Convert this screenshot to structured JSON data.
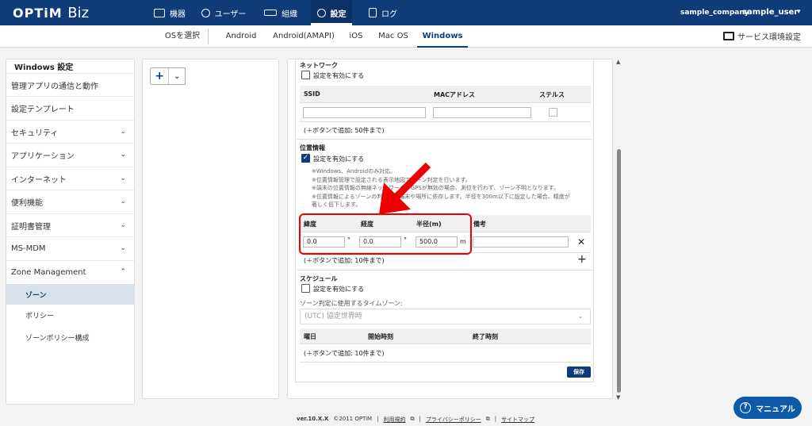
{
  "brand": {
    "logo": "OPTiM",
    "product": "Biz"
  },
  "nav": [
    {
      "label": "機器",
      "icon": "device-icon"
    },
    {
      "label": "ユーザー",
      "icon": "user-icon"
    },
    {
      "label": "組織",
      "icon": "organization-icon"
    },
    {
      "label": "設定",
      "icon": "gear-icon",
      "active": true
    },
    {
      "label": "ログ",
      "icon": "log-icon"
    }
  ],
  "account": {
    "company": "sample_company",
    "user": "sample_user"
  },
  "os_tabs": {
    "select_label": "OSを選択",
    "tabs": [
      "Android",
      "Android(AMAPI)",
      "iOS",
      "Mac OS",
      "Windows"
    ],
    "active": "Windows"
  },
  "env_settings": "サービス環境設定",
  "sidebar": {
    "title": "Windows 設定",
    "items": [
      {
        "label": "管理アプリの通信と動作"
      },
      {
        "label": "設定テンプレート"
      },
      {
        "label": "セキュリティ"
      },
      {
        "label": "アプリケーション"
      },
      {
        "label": "インターネット"
      },
      {
        "label": "便利機能"
      },
      {
        "label": "証明書管理"
      },
      {
        "label": "MS-MDM"
      },
      {
        "label": "Zone Management"
      }
    ],
    "sub_items": [
      {
        "label": "ゾーン",
        "active": true
      },
      {
        "label": "ポリシー"
      },
      {
        "label": "ゾーンポリシー構成"
      }
    ]
  },
  "add_button": {
    "plus": "+",
    "chevron": "⌄"
  },
  "network": {
    "title": "ネットワーク",
    "enable_label": "設定を有効にする",
    "columns": [
      "SSID",
      "MACアドレス",
      "ステルス"
    ],
    "add_hint": "(＋ボタンで追加: 50件まで)"
  },
  "location": {
    "title": "位置情報",
    "enable_label": "設定を有効にする",
    "enabled": true,
    "notes": [
      "※Windows、Androidのみ対応。",
      "※位置情報管理で設定される表示地図でゾーン判定を行います。",
      "※端末の位置情報の無線ネットワーク・GPSが無効の場合、測位を行わず、ゾーン不明となります。",
      "※位置情報によるゾーンの判定は、端末や場所に依存します。半径を300m以下に設定した場合、精度が",
      "著しく低下します。"
    ],
    "columns": {
      "lat": "緯度",
      "lng": "経度",
      "radius": "半径(m)",
      "note": "備考"
    },
    "row": {
      "lat": "0.0",
      "lng": "0.0",
      "radius": "500.0",
      "deg": "°",
      "unit": "m",
      "remove": "✕"
    },
    "add_hint": "(＋ボタンで追加: 10件まで)",
    "add_plus": "+"
  },
  "schedule": {
    "title": "スケジュール",
    "enable_label": "設定を有効にする",
    "tz_label": "ゾーン判定に使用するタイムゾーン:",
    "tz_value": "(UTC) 協定世界時",
    "columns": [
      "曜日",
      "開始時刻",
      "終了時刻"
    ],
    "add_hint": "(＋ボタンで追加: 10件まで)"
  },
  "save_label": "保存",
  "footer": {
    "version": "ver.10.X.X",
    "copyright": "©2011 OPTiM",
    "links": [
      "利用規約",
      "プライバシーポリシー",
      "サイトマップ"
    ]
  },
  "manual_label": "マニュアル",
  "colors": {
    "header": "#0f3b78",
    "highlight": "#e00000",
    "manual": "#0d5aa8"
  }
}
